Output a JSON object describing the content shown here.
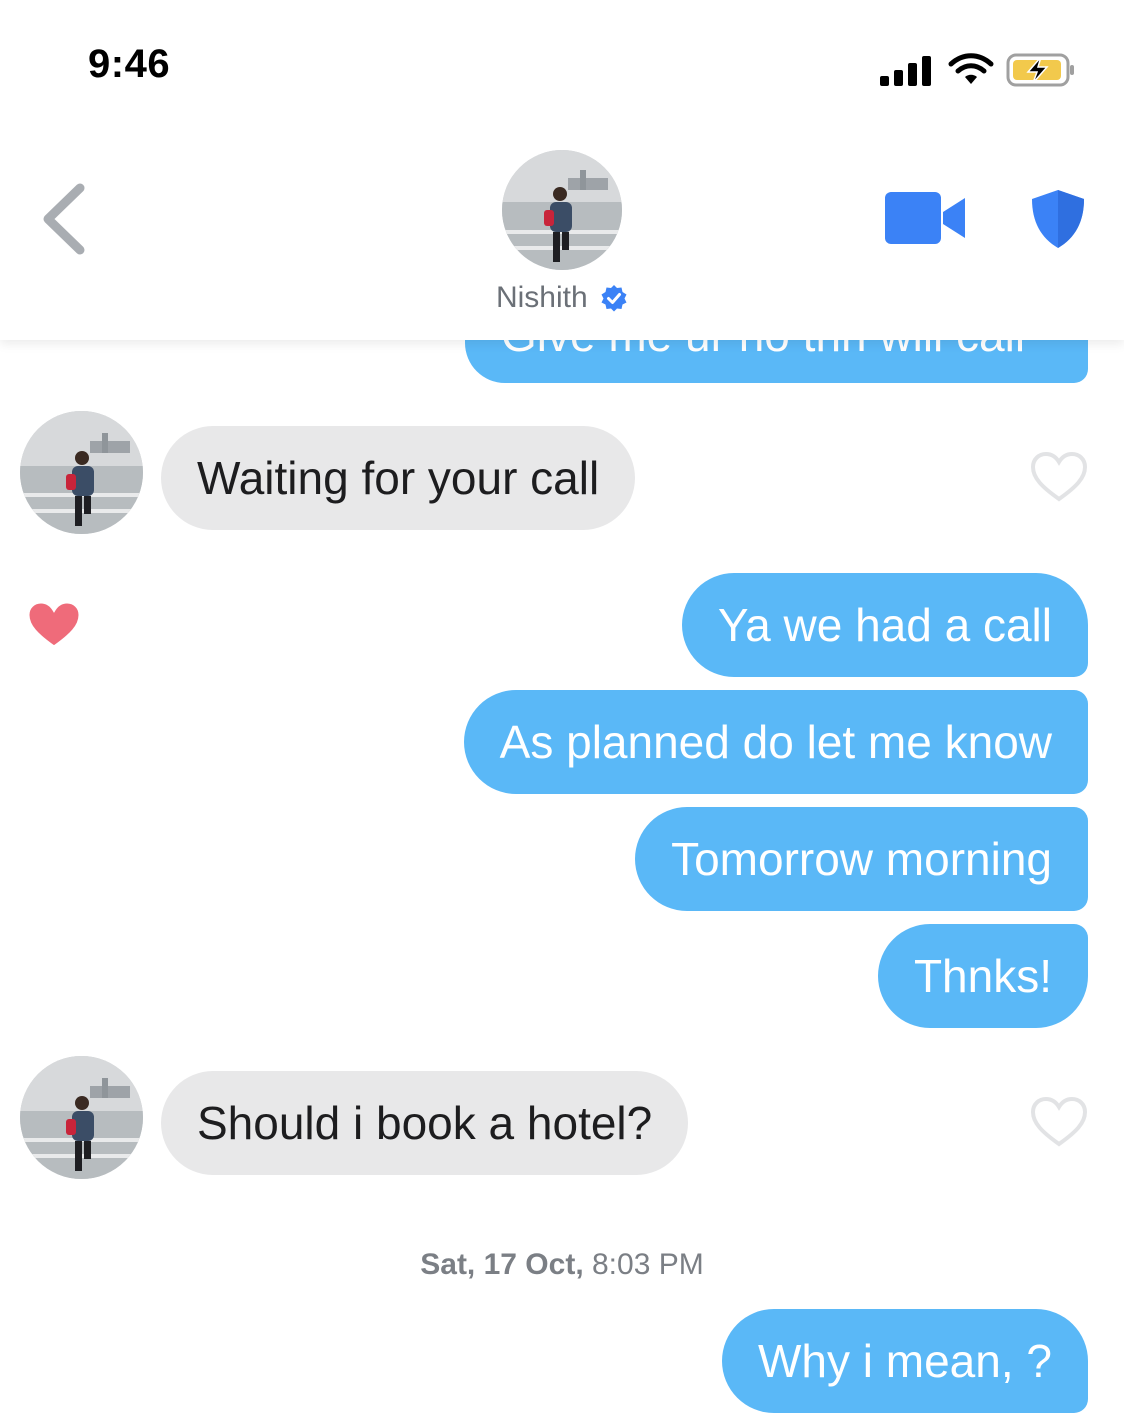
{
  "status_bar": {
    "time": "9:46"
  },
  "header": {
    "contact_name": "Nishith",
    "verified": true,
    "accent_color": "#3b82f6"
  },
  "colors": {
    "outgoing_bubble": "#5ab8f7",
    "incoming_bubble": "#e8e8e9",
    "liked_heart": "#ef6b7a"
  },
  "messages": [
    {
      "direction": "out",
      "text": "Give me ur no thn will call",
      "partially_hidden": true
    },
    {
      "direction": "in",
      "text": "Waiting for your call",
      "liked": false
    },
    {
      "direction": "out",
      "text": "Ya we had a call",
      "liked": true
    },
    {
      "direction": "out",
      "text": "As planned do let me know"
    },
    {
      "direction": "out",
      "text": "Tomorrow morning"
    },
    {
      "direction": "out",
      "text": "Thnks!"
    },
    {
      "direction": "in",
      "text": "Should i book a hotel?",
      "liked": false
    },
    {
      "direction": "out",
      "text": "Why i mean, ?"
    }
  ],
  "timestamp": {
    "date": "Sat, 17 Oct,",
    "time": "8:03 PM"
  }
}
